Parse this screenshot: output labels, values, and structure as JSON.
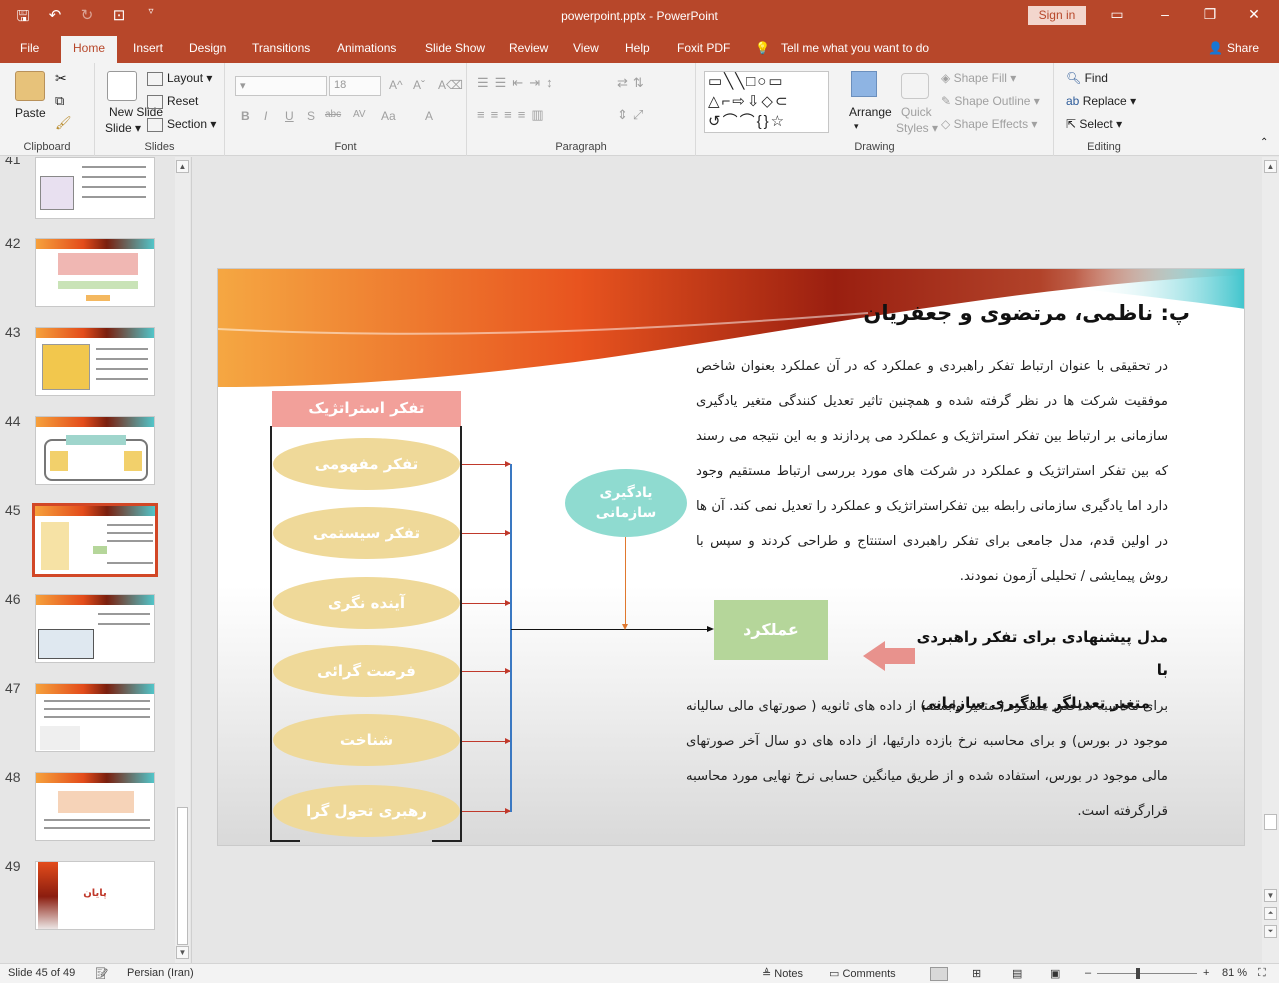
{
  "titlebar": {
    "doc_title": "powerpoint.pptx  -  PowerPoint",
    "signin": "Sign in"
  },
  "tabs": [
    "File",
    "Home",
    "Insert",
    "Design",
    "Transitions",
    "Animations",
    "Slide Show",
    "Review",
    "View",
    "Help",
    "Foxit PDF"
  ],
  "tell_me": "Tell me what you want to do",
  "share": "Share",
  "ribbon": {
    "clipboard": {
      "paste": "Paste",
      "label": "Clipboard"
    },
    "slides": {
      "new_slide": "New Slide",
      "new_slide_b": "Slide",
      "layout": "Layout",
      "reset": "Reset",
      "section": "Section",
      "label": "Slides"
    },
    "font": {
      "size": "18",
      "label": "Font",
      "format_buttons": [
        "B",
        "I",
        "U",
        "S",
        "abc",
        "AV",
        "Aa",
        "A"
      ]
    },
    "paragraph": {
      "label": "Paragraph"
    },
    "drawing": {
      "arrange": "Arrange",
      "quick_styles": "Quick",
      "quick_styles_b": "Styles",
      "shape_fill": "Shape Fill",
      "shape_outline": "Shape Outline",
      "shape_effects": "Shape Effects",
      "label": "Drawing"
    },
    "editing": {
      "find": "Find",
      "replace": "Replace",
      "select": "Select",
      "label": "Editing"
    }
  },
  "thumbnails": [
    {
      "num": "41",
      "selected": false
    },
    {
      "num": "42",
      "selected": false
    },
    {
      "num": "43",
      "selected": false
    },
    {
      "num": "44",
      "selected": false
    },
    {
      "num": "45",
      "selected": true
    },
    {
      "num": "46",
      "selected": false
    },
    {
      "num": "47",
      "selected": false
    },
    {
      "num": "48",
      "selected": false
    },
    {
      "num": "49",
      "selected": false,
      "text": "پایان"
    }
  ],
  "slide": {
    "title": "پ: ناظمی، مرتضوی و جعفریان",
    "paragraph1": "در تحقیقی با عنوان ارتباط تفکر راهبردی و عملکرد که در آن عملکرد بعنوان شاخص موفقیت شرکت ها در نظر گرفته شده  و همچنین تاثیر تعدیل کنندگی متغیر یادگیری سازمانی بر ارتباط بین تفکر استراتژیک و عملکرد می پردازند و به این نتیجه می رسند که بین تفکر استراتژیک و عملکرد در شرکت های مورد بررسی ارتباط مستقیم وجود دارد اما یادگیری سازمانی رابطه بین تفکراستراتژیک و عملکرد را تعدیل نمی کند. آن ها در اولین قدم، مدل جامعی برای تفکر راهبردی استنتاج و طراحی کردند و سپس با روش پیمایشی / تحلیلی آزمون نمودند.",
    "model_caption_1": "مدل پیشنهادی برای تفکر راهبردی با",
    "model_caption_2": "متغیر تعدیلگر یادگیری سازمانی",
    "paragraph2": "برای محاسبه شاخص عملکرد ( متغیر وابسته) از داده های ثانویه ( صورتهای مالی سالیانه موجود در بورس) و برای محاسبه نرخ بازده دارئیها، از داده های دو سال آخر صورتهای مالی موجود در بورس، استفاده شده و از طریق میانگین حسابی نرخ نهایی مورد محاسبه قرارگرفته است.",
    "diagram": {
      "header": "تفکر استراتژیک",
      "items": [
        "تفکر مفهومی",
        "تفکر سیستمی",
        "آینده نگری",
        "فرصت گرائی",
        "شناخت",
        "رهبری تحول گرا"
      ],
      "moderator": "یادگیری سازمانی",
      "outcome": "عملکرد"
    },
    "colors": {
      "header": "#f2a09a",
      "oval": "#efd999",
      "moderator": "#8fdbd0",
      "outcome": "#b5d69a",
      "arrow": "#e8928d"
    }
  },
  "status": {
    "slide_info": "Slide 45 of 49",
    "language": "Persian (Iran)",
    "notes": "Notes",
    "comments": "Comments",
    "zoom": "81 %"
  }
}
